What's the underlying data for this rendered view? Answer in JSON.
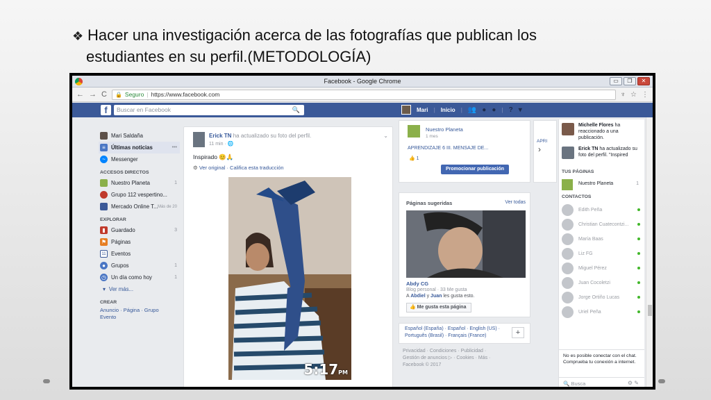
{
  "slide": {
    "bullet": "❖",
    "title_line1": "Hacer una investigación acerca de las fotografías que publican los",
    "title_line2": "estudiantes en su perfil.(METODOLOGÍA)"
  },
  "browser": {
    "window_title": "Facebook - Google Chrome",
    "secure_label": "Seguro",
    "url": "https://www.facebook.com"
  },
  "fb": {
    "search_placeholder": "Buscar en Facebook",
    "user_name": "Mari",
    "home_label": "Inicio"
  },
  "sidebar": {
    "profile": "Mari Saldaña",
    "news": "Últimas noticias",
    "news_more": "•••",
    "messenger": "Messenger",
    "shortcuts_heading": "ACCESOS DIRECTOS",
    "shortcuts": [
      {
        "label": "Nuestro Planeta",
        "count": "1"
      },
      {
        "label": "Grupo 112 vespertino...",
        "count": ""
      },
      {
        "label": "Mercado Online T...",
        "count": "Más de 20"
      }
    ],
    "explore_heading": "EXPLORAR",
    "explore": [
      {
        "label": "Guardado",
        "count": "3",
        "icon": "bookmark-icon",
        "color": "#c0392b"
      },
      {
        "label": "Páginas",
        "count": "",
        "icon": "flag-icon",
        "color": "#e67e22"
      },
      {
        "label": "Eventos",
        "count": "",
        "icon": "calendar-icon",
        "color": "#3b5998"
      },
      {
        "label": "Grupos",
        "count": "1",
        "icon": "groups-icon",
        "color": "#4a76c4"
      },
      {
        "label": "Un día como hoy",
        "count": "1",
        "icon": "clock-icon",
        "color": "#4a76c4"
      }
    ],
    "see_more": "Ver más...",
    "create_heading": "CREAR",
    "create_links": "Anuncio · Página · Grupo",
    "create_links2": "Evento"
  },
  "post": {
    "author": "Erick TN",
    "action": "ha actualizado su foto del perfil.",
    "time": "11 min · 🌐",
    "text": "Inspirado 😊🙏",
    "see_original": "Ver original",
    "rate_translation": "Califica esta traducción",
    "photo_time": "5:17",
    "photo_pm": "PM"
  },
  "ad": {
    "page": "Nuestro Planeta",
    "sub": "1 mes",
    "text": "APRENDIZAJE 6 III. MENSAJE DE...",
    "likes": "1",
    "promote": "Promocionar publicación",
    "side_text": "APRI"
  },
  "suggested": {
    "heading": "Páginas sugeridas",
    "see_all": "Ver todas",
    "name": "Abdy CG",
    "desc": "Blog personal · 33 Me gusta",
    "friends_prefix": "A",
    "friend1": "Abdiel",
    "friends_mid": "y",
    "friend2": "Juan",
    "friends_suffix": "les gusta esto.",
    "like_button": "Me gusta esta página"
  },
  "languages": {
    "line1": "Español (España) · Español · English (US) ·",
    "line2": "Português (Brasil) · Français (France)"
  },
  "footer": {
    "line1": "Privacidad · Condiciones · Publicidad ·",
    "line2": "Gestión de anuncios ▷ · Cookies · Más ·",
    "line3": "Facebook © 2017"
  },
  "rightbar": {
    "notif1_name": "Michelle Flores",
    "notif1_text": "ha reaccionado a una publicación.",
    "notif2_name": "Erick TN",
    "notif2_text": "ha actualizado su foto del perfil. \"Inspired",
    "pages_heading": "TUS PÁGINAS",
    "page_name": "Nuestro Planeta",
    "page_count": "1",
    "contacts_heading": "CONTACTOS",
    "contacts": [
      "Edith Peña",
      "Christian Cuatecontzi...",
      "María Baas",
      "Liz FG",
      "Miguel Pérez",
      "Juan Cocoletzi",
      "Jorge Ortiño Lucas",
      "Uriel Peña"
    ],
    "chat_warning": "No es posible conectar con el chat. Comprueba tu conexión a internet.",
    "chat_search": "Busca"
  }
}
